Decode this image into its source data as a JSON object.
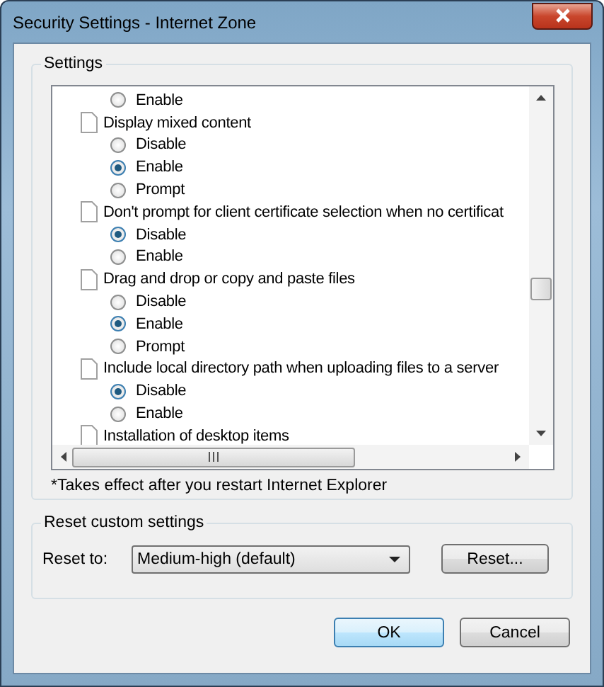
{
  "window": {
    "title": "Security Settings - Internet Zone"
  },
  "settings_group": {
    "title": "Settings",
    "items": [
      {
        "kind": "option",
        "label": "Enable",
        "selected": false
      },
      {
        "kind": "setting",
        "label": "Display mixed content"
      },
      {
        "kind": "option",
        "label": "Disable",
        "selected": false
      },
      {
        "kind": "option",
        "label": "Enable",
        "selected": true
      },
      {
        "kind": "option",
        "label": "Prompt",
        "selected": false
      },
      {
        "kind": "setting",
        "label": "Don't prompt for client certificate selection when no certificat"
      },
      {
        "kind": "option",
        "label": "Disable",
        "selected": true
      },
      {
        "kind": "option",
        "label": "Enable",
        "selected": false
      },
      {
        "kind": "setting",
        "label": "Drag and drop or copy and paste files"
      },
      {
        "kind": "option",
        "label": "Disable",
        "selected": false
      },
      {
        "kind": "option",
        "label": "Enable",
        "selected": true
      },
      {
        "kind": "option",
        "label": "Prompt",
        "selected": false
      },
      {
        "kind": "setting",
        "label": "Include local directory path when uploading files to a server"
      },
      {
        "kind": "option",
        "label": "Disable",
        "selected": true
      },
      {
        "kind": "option",
        "label": "Enable",
        "selected": false
      },
      {
        "kind": "setting",
        "label": "Installation of desktop items"
      }
    ],
    "note": "*Takes effect after you restart Internet Explorer"
  },
  "reset_group": {
    "title": "Reset custom settings",
    "label": "Reset to:",
    "value": "Medium-high (default)",
    "button": "Reset..."
  },
  "buttons": [
    {
      "label": "OK",
      "default": true
    },
    {
      "label": "Cancel",
      "default": false
    }
  ]
}
